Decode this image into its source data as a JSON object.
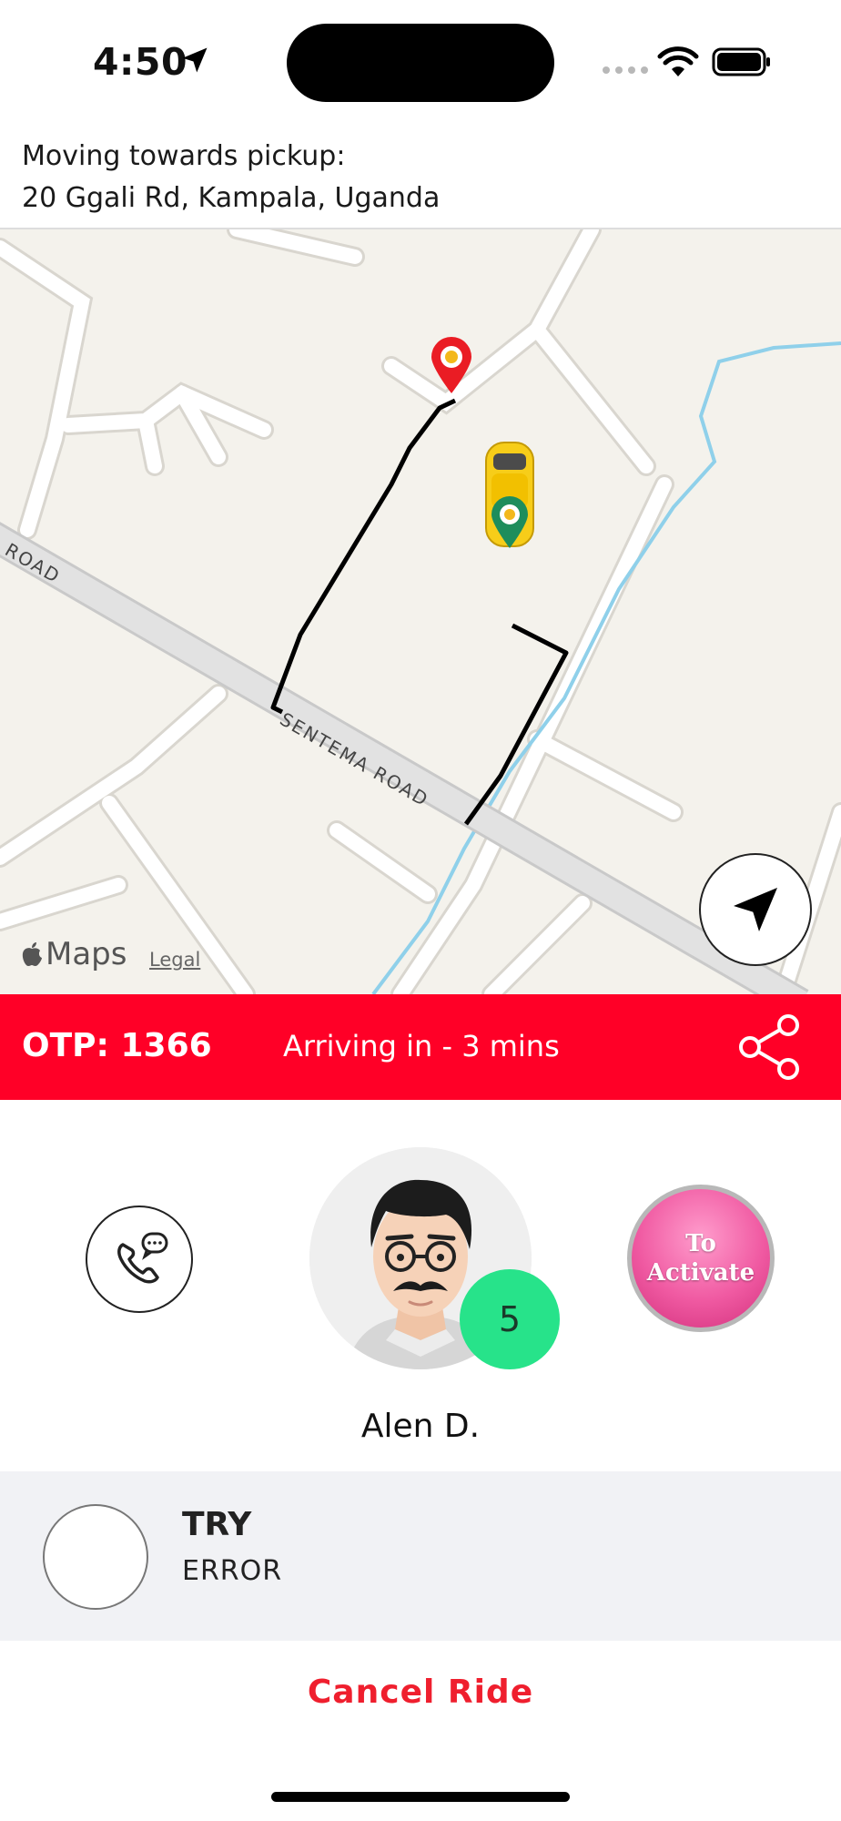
{
  "status_bar": {
    "time": "4:50"
  },
  "pickup": {
    "label": "Moving towards pickup:",
    "address": "20 Ggali Rd, Kampala, Uganda"
  },
  "map": {
    "road_label_left": "ROAD",
    "road_label_main": "SENTEMA ROAD",
    "provider": "Maps",
    "legal": "Legal",
    "pickup_marker_icon": "red-location-pin-icon",
    "driver_icon": "yellow-taxi-car-icon",
    "route_color": "#000000"
  },
  "ride_status": {
    "otp": "OTP: 1366",
    "eta": "Arriving in - 3 mins",
    "bar_color": "#ff0027"
  },
  "driver": {
    "name": "Alen D.",
    "rating": "5",
    "activate_label_1": "To",
    "activate_label_2": "Activate"
  },
  "vehicle": {
    "title": "TRY",
    "subtitle": "ERROR"
  },
  "actions": {
    "cancel": "Cancel Ride"
  }
}
